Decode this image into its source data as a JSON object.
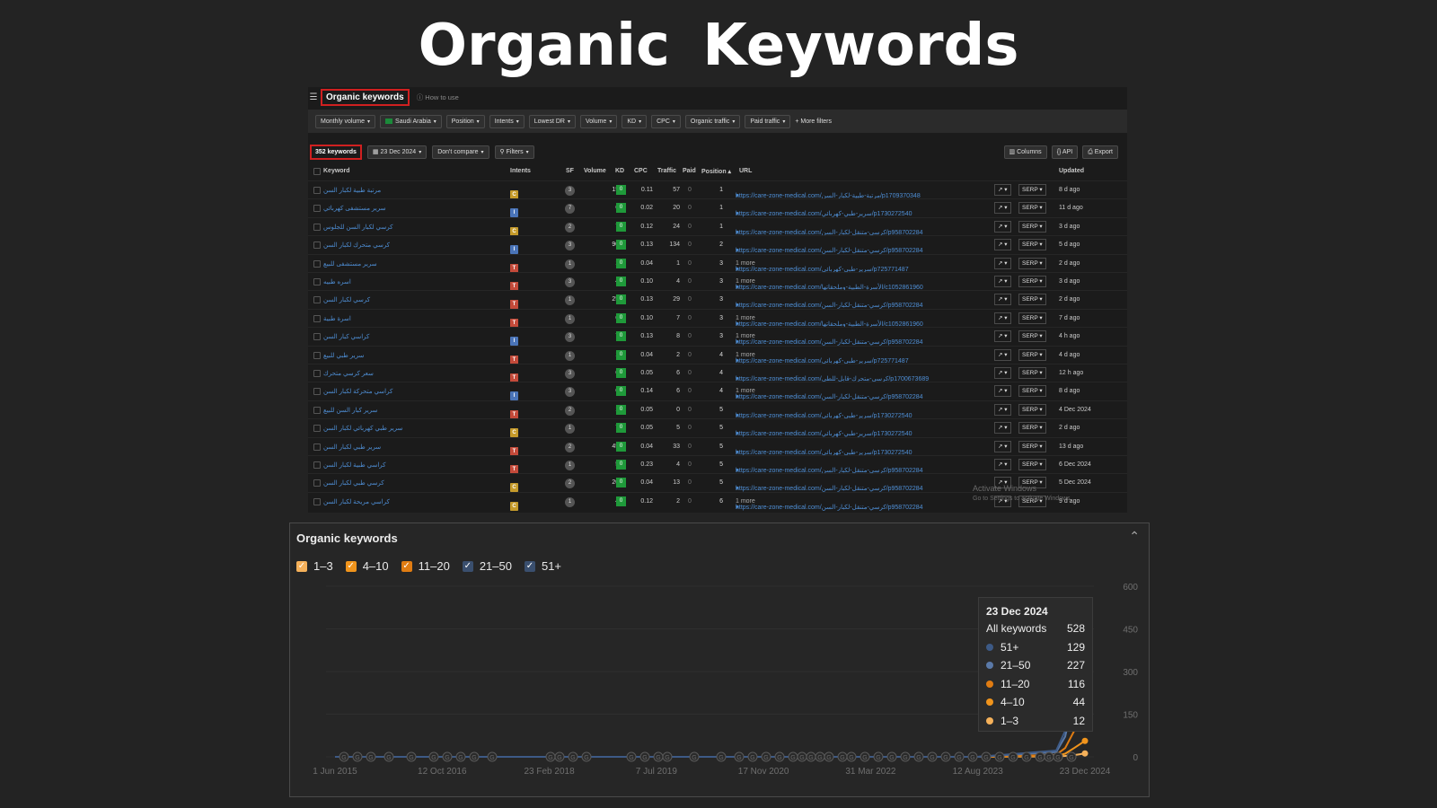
{
  "page_title": "Organic Keywords",
  "screenshot": {
    "header_title": "Organic keywords",
    "how_to": "How to use",
    "filters": [
      "Monthly volume",
      "Saudi Arabia",
      "Position",
      "Intents",
      "Lowest DR",
      "Volume",
      "KD",
      "CPC",
      "Organic traffic",
      "Paid traffic"
    ],
    "more_filters": "More filters",
    "keyword_count": "352 keywords",
    "date": "23 Dec 2024",
    "compare": "Don't compare",
    "filters_btn": "Filters",
    "columns_btn": "Columns",
    "api_btn": "API",
    "export_btn": "Export",
    "columns": [
      "Keyword",
      "Intents",
      "SF",
      "Volume",
      "KD",
      "CPC",
      "Traffic",
      "Paid",
      "Position ▴",
      "URL",
      "Updated"
    ],
    "row_buttons": {
      "chart": "↗ ▾",
      "serp": "SERP ▾"
    },
    "rows": [
      {
        "kw": "مرتبة طبية لكبار السن",
        "intents": "IC",
        "sf": "3",
        "vol": "150",
        "kd": "0",
        "cpc": "0.11",
        "traffic": "57",
        "paid": "0",
        "pos": "1",
        "url": "https://care-zone-medical.com/مرتبة-طبية-لكبار-السن/p1709370348",
        "more": "",
        "upd": "8 d ago"
      },
      {
        "kw": "سرير مستشفى كهربائي",
        "intents": "I",
        "sf": "7",
        "vol": "60",
        "kd": "0",
        "cpc": "0.02",
        "traffic": "20",
        "paid": "0",
        "pos": "1",
        "url": "https://care-zone-medical.com/سرير-طبي-كهربائي/p1730272540",
        "more": "",
        "upd": "11 d ago"
      },
      {
        "kw": "كرسي لكبار السن للجلوس",
        "intents": "IC",
        "sf": "2",
        "vol": "70",
        "kd": "0",
        "cpc": "0.12",
        "traffic": "24",
        "paid": "0",
        "pos": "1",
        "url": "https://care-zone-medical.com/كرسي-متنقل-لكبار-السن/p958702284",
        "more": "",
        "upd": "3 d ago"
      },
      {
        "kw": "كرسي متحرك لكبار السن",
        "intents": "I",
        "sf": "3",
        "vol": "900",
        "kd": "0",
        "cpc": "0.13",
        "traffic": "134",
        "paid": "0",
        "pos": "2",
        "url": "https://care-zone-medical.com/كرسي-متنقل-لكبار-السن/p958702284",
        "more": "",
        "upd": "5 d ago"
      },
      {
        "kw": "سرير مستشفى للبيع",
        "intents": "ICT",
        "sf": "1",
        "vol": "10",
        "kd": "0",
        "cpc": "0.04",
        "traffic": "1",
        "paid": "0",
        "pos": "3",
        "url": "https://care-zone-medical.com/سرير-طبي-كهربائي/p725771487",
        "more": "1 more",
        "upd": "2 d ago"
      },
      {
        "kw": "اسره طبيه",
        "intents": "ICT",
        "sf": "3",
        "vol": "40",
        "kd": "0",
        "cpc": "0.10",
        "traffic": "4",
        "paid": "0",
        "pos": "3",
        "url": "https://care-zone-medical.com/الأسرة-الطبية-وملحقاتها/c1052861960",
        "more": "1 more",
        "upd": "3 d ago"
      },
      {
        "kw": "كرسي لكبار السن",
        "intents": "ICT",
        "sf": "1",
        "vol": "250",
        "kd": "0",
        "cpc": "0.13",
        "traffic": "29",
        "paid": "0",
        "pos": "3",
        "url": "https://care-zone-medical.com/كرسي-متنقل-لكبار-السن/p958702284",
        "more": "",
        "upd": "2 d ago"
      },
      {
        "kw": "اسرة طبية",
        "intents": "ICT",
        "sf": "1",
        "vol": "60",
        "kd": "0",
        "cpc": "0.10",
        "traffic": "7",
        "paid": "0",
        "pos": "3",
        "url": "https://care-zone-medical.com/الأسرة-الطبية-وملحقاتها/c1052861960",
        "more": "1 more",
        "upd": "7 d ago"
      },
      {
        "kw": "كراسي كبار السن",
        "intents": "I",
        "sf": "3",
        "vol": "70",
        "kd": "0",
        "cpc": "0.13",
        "traffic": "8",
        "paid": "0",
        "pos": "3",
        "url": "https://care-zone-medical.com/كرسي-متنقل-لكبار-السن/p958702284",
        "more": "1 more",
        "upd": "4 h ago"
      },
      {
        "kw": "سرير طبي للبيع",
        "intents": "ICT",
        "sf": "1",
        "vol": "10",
        "kd": "0",
        "cpc": "0.04",
        "traffic": "2",
        "paid": "0",
        "pos": "4",
        "url": "https://care-zone-medical.com/سرير-طبي-كهربائي/p725771487",
        "more": "1 more",
        "upd": "4 d ago"
      },
      {
        "kw": "سعر كرسي متحرك",
        "intents": "ICT",
        "sf": "3",
        "vol": "60",
        "kd": "0",
        "cpc": "0.05",
        "traffic": "6",
        "paid": "0",
        "pos": "4",
        "url": "https://care-zone-medical.com/كرسي-متحرك-قابل-للطي/p1700673689",
        "more": "",
        "upd": "12 h ago"
      },
      {
        "kw": "كراسي متحركة لكبار السن",
        "intents": "I",
        "sf": "3",
        "vol": "60",
        "kd": "0",
        "cpc": "0.14",
        "traffic": "6",
        "paid": "0",
        "pos": "4",
        "url": "https://care-zone-medical.com/كرسي-متنقل-لكبار-السن/p958702284",
        "more": "1 more",
        "upd": "8 d ago"
      },
      {
        "kw": "سرير كبار السن للبيع",
        "intents": "ICT",
        "sf": "2",
        "vol": "10",
        "kd": "0",
        "cpc": "0.05",
        "traffic": "0",
        "paid": "0",
        "pos": "5",
        "url": "https://care-zone-medical.com/سرير-طبي-كهربائي/p1730272540",
        "more": "",
        "upd": "4 Dec 2024"
      },
      {
        "kw": "سرير طبي كهربائي لكبار السن",
        "intents": "IC",
        "sf": "1",
        "vol": "70",
        "kd": "0",
        "cpc": "0.05",
        "traffic": "5",
        "paid": "0",
        "pos": "5",
        "url": "https://care-zone-medical.com/سرير-طبي-كهربائي/p1730272540",
        "more": "",
        "upd": "2 d ago"
      },
      {
        "kw": "سرير طبي لكبار السن",
        "intents": "ICT",
        "sf": "2",
        "vol": "450",
        "kd": "0",
        "cpc": "0.04",
        "traffic": "33",
        "paid": "0",
        "pos": "5",
        "url": "https://care-zone-medical.com/سرير-طبي-كهربائي/p1730272540",
        "more": "",
        "upd": "13 d ago"
      },
      {
        "kw": "كراسي طبية لكبار السن",
        "intents": "ICT",
        "sf": "1",
        "vol": "50",
        "kd": "0",
        "cpc": "0.23",
        "traffic": "4",
        "paid": "0",
        "pos": "5",
        "url": "https://care-zone-medical.com/كرسي-متنقل-لكبار-السن/p958702284",
        "more": "",
        "upd": "6 Dec 2024"
      },
      {
        "kw": "كرسي طبي لكبار السن",
        "intents": "IC",
        "sf": "2",
        "vol": "200",
        "kd": "0",
        "cpc": "0.04",
        "traffic": "13",
        "paid": "0",
        "pos": "5",
        "url": "https://care-zone-medical.com/كرسي-متنقل-لكبار-السن/p958702284",
        "more": "",
        "upd": "5 Dec 2024"
      },
      {
        "kw": "كراسي مريحة لكبار السن",
        "intents": "IC",
        "sf": "1",
        "vol": "40",
        "kd": "0",
        "cpc": "0.12",
        "traffic": "2",
        "paid": "0",
        "pos": "6",
        "url": "https://care-zone-medical.com/كرسي-متنقل-لكبار-السن/p958702284",
        "more": "1 more",
        "upd": "9 d ago"
      }
    ],
    "watermark": {
      "line1": "Activate Windows",
      "line2": "Go to Settings to activate Windows."
    }
  },
  "panel": {
    "title": "Organic keywords",
    "legend": [
      {
        "label": "1–3",
        "color": "#f5b15a",
        "checked": true
      },
      {
        "label": "4–10",
        "color": "#f0941c",
        "checked": true
      },
      {
        "label": "11–20",
        "color": "#e07c12",
        "checked": true
      },
      {
        "label": "21–50",
        "color": "#5a79a8",
        "checked": true
      },
      {
        "label": "51+",
        "color": "#3d5a86",
        "checked": true
      }
    ],
    "tooltip": {
      "date": "23 Dec 2024",
      "all_label": "All keywords",
      "all_value": "528",
      "rows": [
        {
          "label": "51+",
          "value": "129",
          "color": "#3d5a86"
        },
        {
          "label": "21–50",
          "value": "227",
          "color": "#5a79a8"
        },
        {
          "label": "11–20",
          "value": "116",
          "color": "#e07c12"
        },
        {
          "label": "4–10",
          "value": "44",
          "color": "#f0941c"
        },
        {
          "label": "1–3",
          "value": "12",
          "color": "#f5b15a"
        }
      ]
    }
  },
  "chart_data": {
    "type": "area",
    "x_tick_labels": [
      "1 Jun 2015",
      "12 Oct 2016",
      "23 Feb 2018",
      "7 Jul 2019",
      "17 Nov 2020",
      "31 Mar 2022",
      "12 Aug 2023",
      "23 Dec 2024"
    ],
    "y_tick_labels": [
      "600",
      "450",
      "300",
      "150",
      "0"
    ],
    "ylim": [
      0,
      600
    ],
    "x": [
      "1 Jun 2015",
      "12 Oct 2016",
      "23 Feb 2018",
      "7 Jul 2019",
      "17 Nov 2020",
      "31 Mar 2022",
      "12 Aug 2023",
      "1 Oct 2024",
      "1 Nov 2024",
      "1 Dec 2024",
      "23 Dec 2024"
    ],
    "series": [
      {
        "name": "51+",
        "values": [
          0,
          0,
          0,
          0,
          0,
          0,
          0,
          5,
          20,
          60,
          129
        ]
      },
      {
        "name": "21–50",
        "values": [
          0,
          0,
          0,
          0,
          0,
          0,
          0,
          10,
          40,
          120,
          227
        ]
      },
      {
        "name": "11–20",
        "values": [
          0,
          0,
          0,
          0,
          0,
          0,
          0,
          4,
          20,
          60,
          116
        ]
      },
      {
        "name": "4–10",
        "values": [
          0,
          0,
          0,
          0,
          0,
          0,
          0,
          2,
          8,
          25,
          44
        ]
      },
      {
        "name": "1–3",
        "values": [
          0,
          0,
          0,
          0,
          0,
          0,
          0,
          1,
          3,
          6,
          12
        ]
      }
    ],
    "annotation_marker": "G",
    "grid": true
  }
}
